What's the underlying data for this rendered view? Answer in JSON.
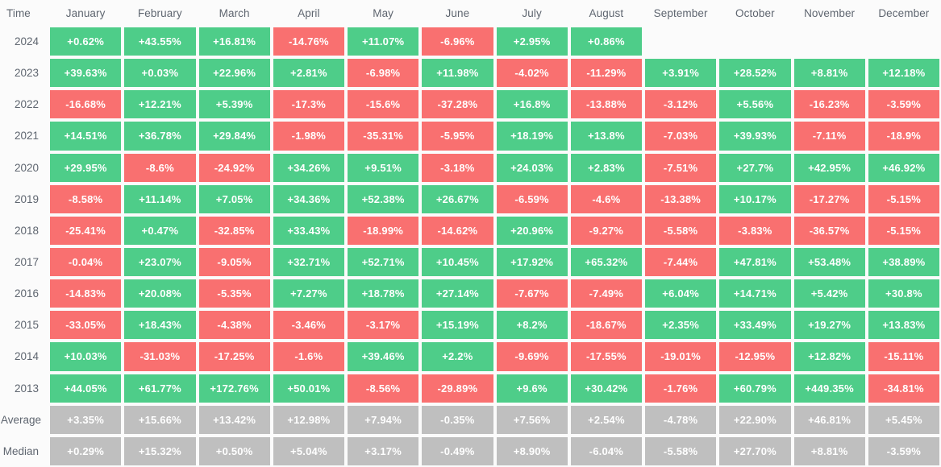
{
  "table": {
    "corner_label": "Time",
    "columns": [
      "January",
      "February",
      "March",
      "April",
      "May",
      "June",
      "July",
      "August",
      "September",
      "October",
      "November",
      "December"
    ],
    "colors": {
      "positive": "#4ecd89",
      "negative": "#f97070",
      "summary": "#bfbfbf",
      "background": "#fbfbfb",
      "header_text": "#5f6670",
      "cell_text": "#ffffff"
    },
    "rows": [
      {
        "label": "2024",
        "type": "year",
        "values": [
          "+0.62%",
          "+43.55%",
          "+16.81%",
          "-14.76%",
          "+11.07%",
          "-6.96%",
          "+2.95%",
          "+0.86%",
          "",
          "",
          "",
          ""
        ]
      },
      {
        "label": "2023",
        "type": "year",
        "values": [
          "+39.63%",
          "+0.03%",
          "+22.96%",
          "+2.81%",
          "-6.98%",
          "+11.98%",
          "-4.02%",
          "-11.29%",
          "+3.91%",
          "+28.52%",
          "+8.81%",
          "+12.18%"
        ]
      },
      {
        "label": "2022",
        "type": "year",
        "values": [
          "-16.68%",
          "+12.21%",
          "+5.39%",
          "-17.3%",
          "-15.6%",
          "-37.28%",
          "+16.8%",
          "-13.88%",
          "-3.12%",
          "+5.56%",
          "-16.23%",
          "-3.59%"
        ]
      },
      {
        "label": "2021",
        "type": "year",
        "values": [
          "+14.51%",
          "+36.78%",
          "+29.84%",
          "-1.98%",
          "-35.31%",
          "-5.95%",
          "+18.19%",
          "+13.8%",
          "-7.03%",
          "+39.93%",
          "-7.11%",
          "-18.9%"
        ]
      },
      {
        "label": "2020",
        "type": "year",
        "values": [
          "+29.95%",
          "-8.6%",
          "-24.92%",
          "+34.26%",
          "+9.51%",
          "-3.18%",
          "+24.03%",
          "+2.83%",
          "-7.51%",
          "+27.7%",
          "+42.95%",
          "+46.92%"
        ]
      },
      {
        "label": "2019",
        "type": "year",
        "values": [
          "-8.58%",
          "+11.14%",
          "+7.05%",
          "+34.36%",
          "+52.38%",
          "+26.67%",
          "-6.59%",
          "-4.6%",
          "-13.38%",
          "+10.17%",
          "-17.27%",
          "-5.15%"
        ]
      },
      {
        "label": "2018",
        "type": "year",
        "values": [
          "-25.41%",
          "+0.47%",
          "-32.85%",
          "+33.43%",
          "-18.99%",
          "-14.62%",
          "+20.96%",
          "-9.27%",
          "-5.58%",
          "-3.83%",
          "-36.57%",
          "-5.15%"
        ]
      },
      {
        "label": "2017",
        "type": "year",
        "values": [
          "-0.04%",
          "+23.07%",
          "-9.05%",
          "+32.71%",
          "+52.71%",
          "+10.45%",
          "+17.92%",
          "+65.32%",
          "-7.44%",
          "+47.81%",
          "+53.48%",
          "+38.89%"
        ]
      },
      {
        "label": "2016",
        "type": "year",
        "values": [
          "-14.83%",
          "+20.08%",
          "-5.35%",
          "+7.27%",
          "+18.78%",
          "+27.14%",
          "-7.67%",
          "-7.49%",
          "+6.04%",
          "+14.71%",
          "+5.42%",
          "+30.8%"
        ]
      },
      {
        "label": "2015",
        "type": "year",
        "values": [
          "-33.05%",
          "+18.43%",
          "-4.38%",
          "-3.46%",
          "-3.17%",
          "+15.19%",
          "+8.2%",
          "-18.67%",
          "+2.35%",
          "+33.49%",
          "+19.27%",
          "+13.83%"
        ]
      },
      {
        "label": "2014",
        "type": "year",
        "values": [
          "+10.03%",
          "-31.03%",
          "-17.25%",
          "-1.6%",
          "+39.46%",
          "+2.2%",
          "-9.69%",
          "-17.55%",
          "-19.01%",
          "-12.95%",
          "+12.82%",
          "-15.11%"
        ]
      },
      {
        "label": "2013",
        "type": "year",
        "values": [
          "+44.05%",
          "+61.77%",
          "+172.76%",
          "+50.01%",
          "-8.56%",
          "-29.89%",
          "+9.6%",
          "+30.42%",
          "-1.76%",
          "+60.79%",
          "+449.35%",
          "-34.81%"
        ]
      },
      {
        "label": "Average",
        "type": "summary",
        "values": [
          "+3.35%",
          "+15.66%",
          "+13.42%",
          "+12.98%",
          "+7.94%",
          "-0.35%",
          "+7.56%",
          "+2.54%",
          "-4.78%",
          "+22.90%",
          "+46.81%",
          "+5.45%"
        ]
      },
      {
        "label": "Median",
        "type": "summary",
        "values": [
          "+0.29%",
          "+15.32%",
          "+0.50%",
          "+5.04%",
          "+3.17%",
          "-0.49%",
          "+8.90%",
          "-6.04%",
          "-5.58%",
          "+27.70%",
          "+8.81%",
          "-3.59%"
        ]
      }
    ]
  },
  "chart_data": {
    "type": "heatmap",
    "title": "",
    "xlabel": "",
    "ylabel": "Time",
    "x": [
      "January",
      "February",
      "March",
      "April",
      "May",
      "June",
      "July",
      "August",
      "September",
      "October",
      "November",
      "December"
    ],
    "y": [
      "2024",
      "2023",
      "2022",
      "2021",
      "2020",
      "2019",
      "2018",
      "2017",
      "2016",
      "2015",
      "2014",
      "2013",
      "Average",
      "Median"
    ],
    "unit": "percent",
    "legend": "green = positive return, red = negative return, gray = summary statistic row",
    "values": [
      [
        0.62,
        43.55,
        16.81,
        -14.76,
        11.07,
        -6.96,
        2.95,
        0.86,
        null,
        null,
        null,
        null
      ],
      [
        39.63,
        0.03,
        22.96,
        2.81,
        -6.98,
        11.98,
        -4.02,
        -11.29,
        3.91,
        28.52,
        8.81,
        12.18
      ],
      [
        -16.68,
        12.21,
        5.39,
        -17.3,
        -15.6,
        -37.28,
        16.8,
        -13.88,
        -3.12,
        5.56,
        -16.23,
        -3.59
      ],
      [
        14.51,
        36.78,
        29.84,
        -1.98,
        -35.31,
        -5.95,
        18.19,
        13.8,
        -7.03,
        39.93,
        -7.11,
        -18.9
      ],
      [
        29.95,
        -8.6,
        -24.92,
        34.26,
        9.51,
        -3.18,
        24.03,
        2.83,
        -7.51,
        27.7,
        42.95,
        46.92
      ],
      [
        -8.58,
        11.14,
        7.05,
        34.36,
        52.38,
        26.67,
        -6.59,
        -4.6,
        -13.38,
        10.17,
        -17.27,
        -5.15
      ],
      [
        -25.41,
        0.47,
        -32.85,
        33.43,
        -18.99,
        -14.62,
        20.96,
        -9.27,
        -5.58,
        -3.83,
        -36.57,
        -5.15
      ],
      [
        -0.04,
        23.07,
        -9.05,
        32.71,
        52.71,
        10.45,
        17.92,
        65.32,
        -7.44,
        47.81,
        53.48,
        38.89
      ],
      [
        -14.83,
        20.08,
        -5.35,
        7.27,
        18.78,
        27.14,
        -7.67,
        -7.49,
        6.04,
        14.71,
        5.42,
        30.8
      ],
      [
        -33.05,
        18.43,
        -4.38,
        -3.46,
        -3.17,
        15.19,
        8.2,
        -18.67,
        2.35,
        33.49,
        19.27,
        13.83
      ],
      [
        10.03,
        -31.03,
        -17.25,
        -1.6,
        39.46,
        2.2,
        -9.69,
        -17.55,
        -19.01,
        -12.95,
        12.82,
        -15.11
      ],
      [
        44.05,
        61.77,
        172.76,
        50.01,
        -8.56,
        -29.89,
        9.6,
        30.42,
        -1.76,
        60.79,
        449.35,
        -34.81
      ],
      [
        3.35,
        15.66,
        13.42,
        12.98,
        7.94,
        -0.35,
        7.56,
        2.54,
        -4.78,
        22.9,
        46.81,
        5.45
      ],
      [
        0.29,
        15.32,
        0.5,
        5.04,
        3.17,
        -0.49,
        8.9,
        -6.04,
        -5.58,
        27.7,
        8.81,
        -3.59
      ]
    ]
  }
}
